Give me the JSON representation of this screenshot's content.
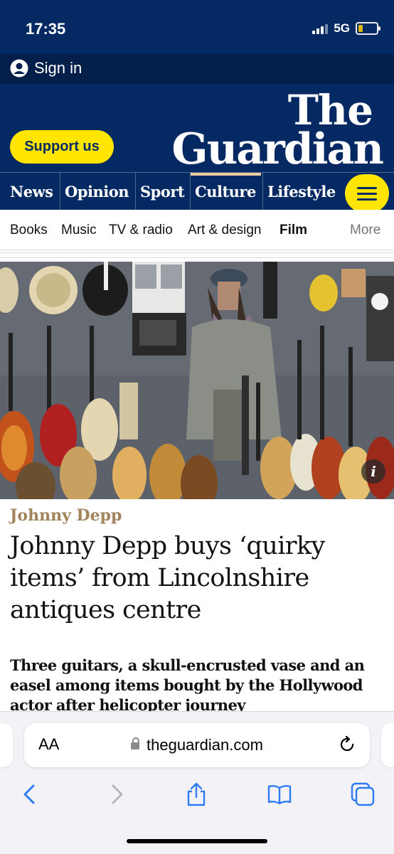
{
  "status": {
    "time": "17:35",
    "network": "5G"
  },
  "header": {
    "signin_label": "Sign in",
    "support_label": "Support us",
    "logo_the": "The",
    "logo_guardian": "Guardian"
  },
  "pillars": [
    "News",
    "Opinion",
    "Sport",
    "Culture",
    "Lifestyle"
  ],
  "active_pillar": "Culture",
  "subnav": [
    "Books",
    "Music",
    "TV & radio",
    "Art & design",
    "Film",
    "More"
  ],
  "active_subnav": "Film",
  "article": {
    "kicker": "Johnny Depp",
    "headline": "Johnny Depp buys ‘quirky items’ from Lincolnshire antiques centre",
    "standfirst": "Three guitars, a skull-encrusted vase and an easel among items bought by the Hollywood actor after helicopter journey",
    "info_label": "i"
  },
  "browser": {
    "text_size_label": "AA",
    "url": "theguardian.com"
  },
  "colors": {
    "brand_navy": "#052962",
    "support_yellow": "#ffe500",
    "culture_kicker": "#a1845c",
    "safari_blue": "#2f7bf6"
  },
  "icons": [
    "user-icon",
    "menu-icon",
    "info-icon",
    "lock-icon",
    "reload-icon",
    "back-icon",
    "forward-icon",
    "share-icon",
    "bookmarks-icon",
    "tabs-icon"
  ]
}
